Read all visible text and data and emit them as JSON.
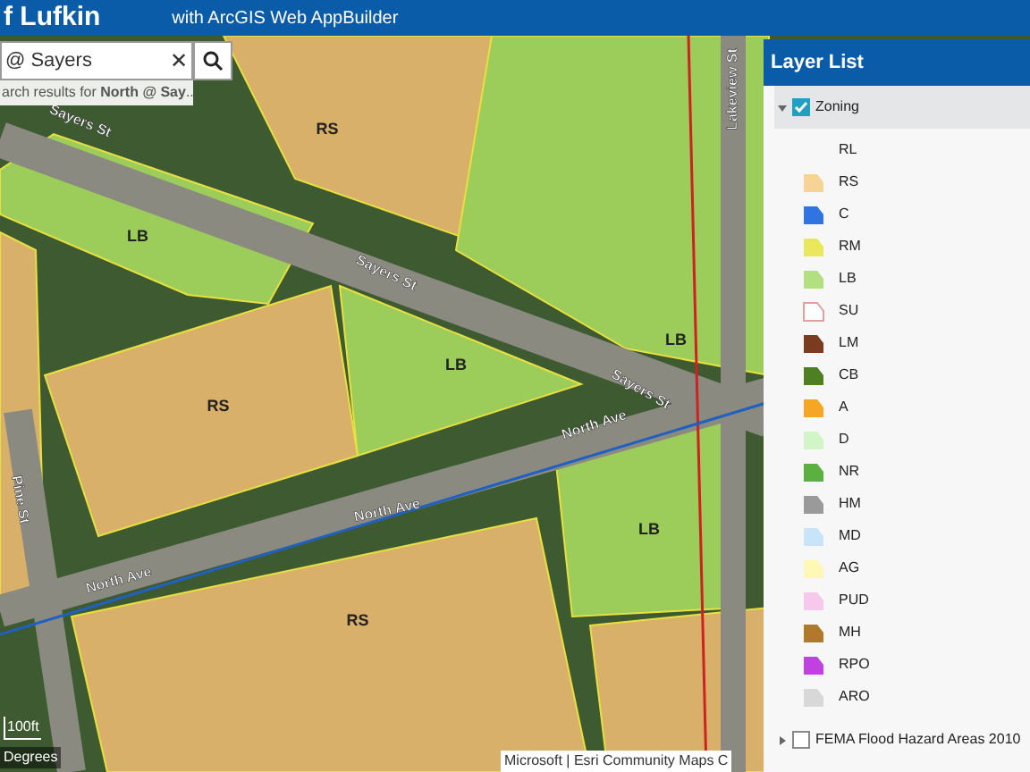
{
  "header": {
    "title": "f Lufkin",
    "subtitle": "with ArcGIS Web AppBuilder"
  },
  "search": {
    "value": "@ Sayers",
    "clear_icon": "✕",
    "suggestion": "arch results for **North @ Say**..."
  },
  "map": {
    "labels": [
      {
        "kind": "zone",
        "text": "RS"
      },
      {
        "kind": "zone",
        "text": "LB"
      },
      {
        "kind": "zone",
        "text": "LB"
      },
      {
        "kind": "zone",
        "text": "RS"
      },
      {
        "kind": "zone",
        "text": "LB"
      },
      {
        "kind": "zone",
        "text": "LB"
      },
      {
        "kind": "zone",
        "text": "RS"
      },
      {
        "kind": "street",
        "text": "Sayers St"
      },
      {
        "kind": "street",
        "text": "Sayers St"
      },
      {
        "kind": "street",
        "text": "Sayers St"
      },
      {
        "kind": "street",
        "text": "North Ave"
      },
      {
        "kind": "street",
        "text": "North Ave"
      },
      {
        "kind": "street",
        "text": "North Ave"
      },
      {
        "kind": "street",
        "text": "Pine St"
      },
      {
        "kind": "street",
        "text": "Lakeview St"
      }
    ],
    "scale": "100ft",
    "coords": "Degrees",
    "attribution": "Microsoft | Esri Community Maps C"
  },
  "layer_list": {
    "title": "Layer List",
    "layers": [
      {
        "name": "Zoning",
        "checked": true,
        "expanded": true,
        "legend": [
          {
            "label": "RL"
          },
          {
            "label": "RS",
            "color": "#f8d398"
          },
          {
            "label": "C",
            "color": "#2f74e0"
          },
          {
            "label": "RM",
            "color": "#e8e85a"
          },
          {
            "label": "LB",
            "color": "#b4df80"
          },
          {
            "label": "SU",
            "color": "#ffffff"
          },
          {
            "label": "LM",
            "color": "#7a3b1e"
          },
          {
            "label": "CB",
            "color": "#4f7f23"
          },
          {
            "label": "A",
            "color": "#f5a623"
          },
          {
            "label": "D",
            "color": "#d2f5c8"
          },
          {
            "label": "NR",
            "color": "#5cb040"
          },
          {
            "label": "HM",
            "color": "#9a9a9a"
          },
          {
            "label": "MD",
            "color": "#c8e4fa"
          },
          {
            "label": "AG",
            "color": "#fff7b8"
          },
          {
            "label": "PUD",
            "color": "#f8c8ec"
          },
          {
            "label": "MH",
            "color": "#b07a28"
          },
          {
            "label": "RPO",
            "color": "#c040e0"
          },
          {
            "label": "ARO",
            "color": "#d8d8d8"
          }
        ]
      },
      {
        "name": "FEMA Flood Hazard Areas 2010",
        "checked": false,
        "expanded": false
      }
    ]
  }
}
